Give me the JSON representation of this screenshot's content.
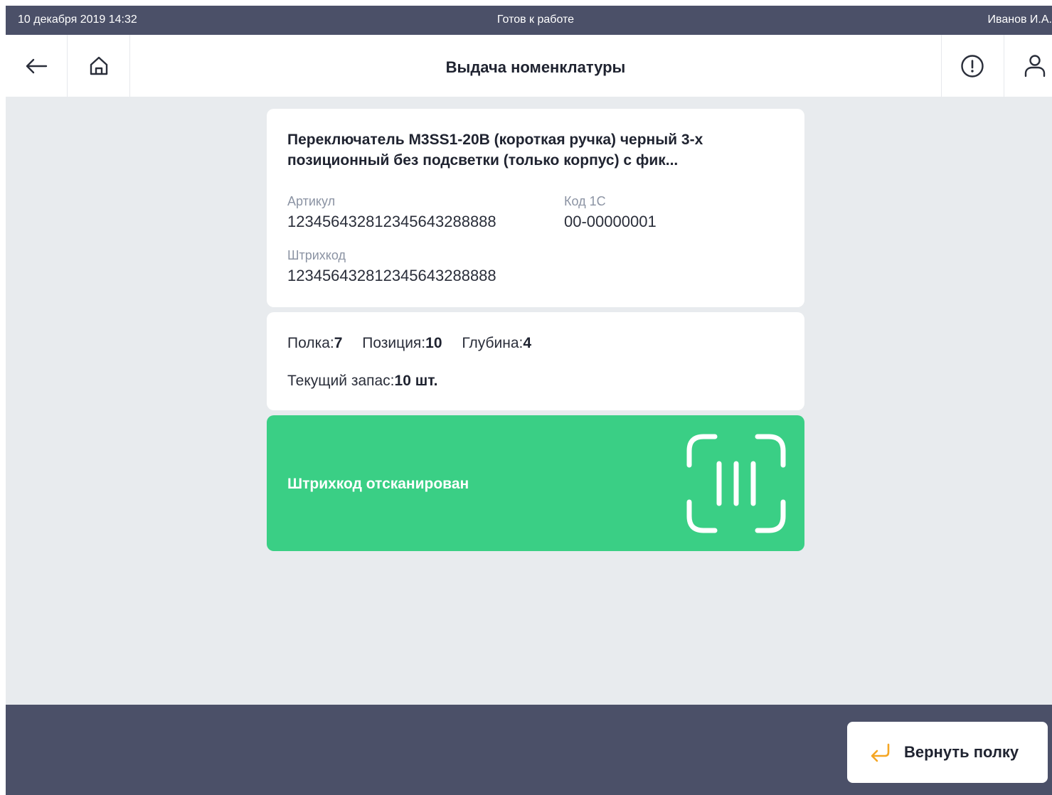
{
  "status_bar": {
    "datetime": "10 декабря 2019 14:32",
    "status": "Готов к работе",
    "user": "Иванов И.А."
  },
  "nav": {
    "title": "Выдача номенклатуры",
    "icons": [
      "arrow-left-icon",
      "home-icon",
      "alert-circle-icon",
      "user-icon"
    ]
  },
  "product": {
    "title_line1": "Переключатель M3SS1-20B (короткая ручка) черный 3-х",
    "title_line2": "позиционный без подсветки (только корпус) с фик...",
    "article_label": "Артикул",
    "article_value": "12345643281234564328​8888",
    "code1c_label": "Код 1С",
    "code1c_value": "00-00000001",
    "barcode_label": "Штрихкод",
    "barcode_value": "12345643281234564328​8888"
  },
  "stock": {
    "shelf_label": "Полка:",
    "shelf_value": "7",
    "position_label": "Позиция:",
    "position_value": "10",
    "depth_label": "Глубина:",
    "depth_value": "4",
    "current_label": "Текущий запас:",
    "current_value": "10 шт."
  },
  "scan": {
    "message": "Штрихкод отсканирован",
    "icon": "barcode-scan-icon",
    "color": "#3acf85"
  },
  "footer": {
    "return_label": "Вернуть полку",
    "return_icon": "return-arrow-icon",
    "accent": "#f5a623"
  }
}
